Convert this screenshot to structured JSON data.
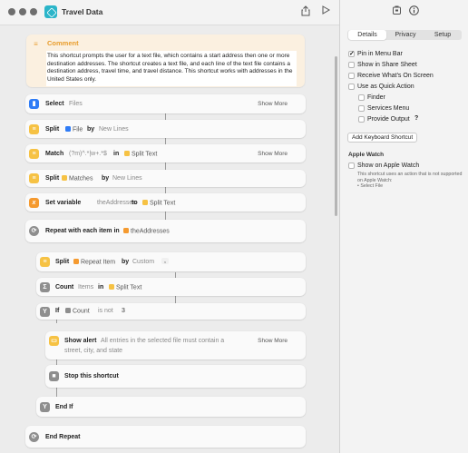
{
  "window": {
    "title": "Travel Data"
  },
  "comment": {
    "title": "Comment",
    "text": "This shortcut prompts the user for a text file, which contains a start address then one or more destination addresses. The shortcut creates a text file, and each line of the text file contains a destination address, travel time, and travel distance. This shortcut works with addresses in the United States only."
  },
  "actions": {
    "select": {
      "label": "Select",
      "param": "Files",
      "more": "Show More"
    },
    "split1": {
      "label": "Split",
      "input": "File",
      "by": "by",
      "sep": "New Lines"
    },
    "match": {
      "label": "Match",
      "pattern": "(?m)^.*|w+.*$",
      "in": "in",
      "input": "Split Text",
      "more": "Show More"
    },
    "split2": {
      "label": "Split",
      "input": "Matches",
      "by": "by",
      "sep": "New Lines"
    },
    "setvar": {
      "label": "Set variable",
      "name": "theAddresses",
      "to": "to",
      "input": "Split Text"
    },
    "repeat": {
      "label": "Repeat with each item in",
      "input": "theAddresses"
    },
    "split3": {
      "label": "Split",
      "input": "Repeat Item",
      "by": "by",
      "sep": "Custom",
      "custom": ","
    },
    "count": {
      "label": "Count",
      "param": "Items",
      "in": "in",
      "input": "Split Text"
    },
    "if": {
      "label": "If",
      "input": "Count",
      "cond": "is not",
      "value": "3"
    },
    "alert": {
      "label": "Show alert",
      "text1": "All entries in the selected file must contain a",
      "text2": "street, city, and state",
      "more": "Show More"
    },
    "stop": {
      "label": "Stop this shortcut"
    },
    "endif": {
      "label": "End If"
    },
    "endrepeat": {
      "label": "End Repeat"
    }
  },
  "sidebar": {
    "tabs": [
      "Details",
      "Privacy",
      "Setup"
    ],
    "options": {
      "pin": "Pin in Menu Bar",
      "share": "Show in Share Sheet",
      "receive": "Receive What's On Screen",
      "quick": "Use as Quick Action",
      "finder": "Finder",
      "services": "Services Menu",
      "provide": "Provide Output",
      "provide_help": "?"
    },
    "keyboard_button": "Add Keyboard Shortcut",
    "watch_title": "Apple Watch",
    "watch_option": "Show on Apple Watch",
    "watch_hint": "This shortcut uses an action that is not supported on Apple Watch:",
    "watch_hint_item": "• Select File"
  },
  "colors": {
    "accent_yellow": "#f6c244",
    "accent_orange": "#f59a2f",
    "accent_blue": "#2f7cf6",
    "accent_gray": "#8e8e8e",
    "accent_teal": "#2bb5c9"
  }
}
